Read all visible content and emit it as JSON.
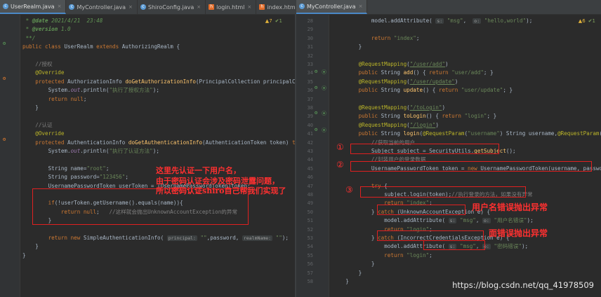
{
  "left_tabs": [
    {
      "name": "UserRealm.java",
      "icon": "c",
      "active": true
    },
    {
      "name": "MyController.java",
      "icon": "c",
      "active": false
    },
    {
      "name": "ShiroConfig.java",
      "icon": "c",
      "active": false
    },
    {
      "name": "login.html",
      "icon": "h",
      "active": false
    },
    {
      "name": "index.html",
      "icon": "h",
      "active": false
    }
  ],
  "right_tabs": [
    {
      "name": "MyController.java",
      "icon": "c",
      "active": true
    }
  ],
  "inspections": {
    "left": {
      "warnings": "7",
      "typos": "1"
    },
    "right": {
      "warnings": "6",
      "typos": "1"
    }
  },
  "left_code": [
    [
      [
        "doc",
        " * "
      ],
      [
        "dtag",
        "@date"
      ],
      [
        "doc",
        " 2021/4/21  23:48"
      ]
    ],
    [
      [
        "doc",
        " * "
      ],
      [
        "dtag",
        "@version"
      ],
      [
        "doc",
        " 1.0"
      ]
    ],
    [
      [
        "doc",
        " **/"
      ]
    ],
    [
      [
        "kw",
        "public class "
      ],
      [
        "t",
        "UserRealm "
      ],
      [
        "kw",
        "extends "
      ],
      [
        "t",
        "AuthorizingRealm {"
      ]
    ],
    [],
    [
      [
        "cmt",
        "    //授权"
      ]
    ],
    [
      [
        "ann",
        "    @Override"
      ]
    ],
    [
      [
        "kw",
        "    protected "
      ],
      [
        "t",
        "AuthorizationInfo "
      ],
      [
        "fn",
        "doGetAuthorizationInfo"
      ],
      [
        "t",
        "(PrincipalCollection principalColle"
      ]
    ],
    [
      [
        "t",
        "        System."
      ],
      [
        "fld",
        "out"
      ],
      [
        "t",
        ".println("
      ],
      [
        "str",
        "\"执行了授权方法\""
      ],
      [
        "t",
        ");"
      ]
    ],
    [
      [
        "kw",
        "        return null"
      ],
      [
        "t",
        ";"
      ]
    ],
    [
      [
        "t",
        "    }"
      ]
    ],
    [],
    [
      [
        "cmt",
        "    //认证"
      ]
    ],
    [
      [
        "ann",
        "    @Override"
      ]
    ],
    [
      [
        "kw",
        "    protected "
      ],
      [
        "t",
        "AuthenticationInfo "
      ],
      [
        "fn",
        "doGetAuthenticationInfo"
      ],
      [
        "t",
        "(AuthenticationToken token) "
      ],
      [
        "kw",
        "throw"
      ]
    ],
    [
      [
        "t",
        "        System."
      ],
      [
        "fld",
        "out"
      ],
      [
        "t",
        ".println("
      ],
      [
        "str",
        "\"执行了认证方法\""
      ],
      [
        "t",
        ");"
      ]
    ],
    [],
    [
      [
        "t",
        "        String name="
      ],
      [
        "str",
        "\"root\""
      ],
      [
        "t",
        ";"
      ]
    ],
    [
      [
        "t",
        "        String password="
      ],
      [
        "str",
        "\"123456\""
      ],
      [
        "t",
        ";"
      ]
    ],
    [
      [
        "t",
        "        UsernamePasswordToken userToken = (UsernamePasswordToken)token;"
      ]
    ],
    [],
    [
      [
        "kw",
        "        if"
      ],
      [
        "t",
        "(!userToken.getUsername().equals(name)){"
      ]
    ],
    [
      [
        "kw",
        "            return null"
      ],
      [
        "t",
        ";   "
      ],
      [
        "cmt",
        "//这样就会抛出UnknownAccountException的异常"
      ]
    ],
    [
      [
        "t",
        "        }"
      ]
    ],
    [],
    [
      [
        "kw",
        "        return new "
      ],
      [
        "t",
        "SimpleAuthenticationInfo( "
      ],
      [
        "pl",
        "principal:"
      ],
      [
        "t",
        " "
      ],
      [
        "str",
        "\"\""
      ],
      [
        "t",
        ",password, "
      ],
      [
        "pl",
        "realmName:"
      ],
      [
        "t",
        " "
      ],
      [
        "str",
        "\"\""
      ],
      [
        "t",
        ");"
      ]
    ],
    [
      [
        "t",
        "    }"
      ]
    ],
    [
      [
        "t",
        "}"
      ]
    ]
  ],
  "right_code": [
    [
      [
        "t",
        "            model.addAttribute( "
      ],
      [
        "pl",
        "s:"
      ],
      [
        "t",
        " "
      ],
      [
        "str",
        "\"msg\""
      ],
      [
        "t",
        ",  "
      ],
      [
        "pl",
        "o:"
      ],
      [
        "t",
        " "
      ],
      [
        "str",
        "\"hello,world\""
      ],
      [
        "t",
        ");"
      ]
    ],
    [],
    [
      [
        "kw",
        "            return "
      ],
      [
        "str",
        "\"index\""
      ],
      [
        "t",
        ";"
      ]
    ],
    [
      [
        "t",
        "        }"
      ]
    ],
    [],
    [
      [
        "ann",
        "        @RequestMapping"
      ],
      [
        "t",
        "("
      ],
      [
        "lnk",
        "\"/user/add\""
      ],
      [
        "t",
        ")"
      ]
    ],
    [
      [
        "kw",
        "        public "
      ],
      [
        "t",
        "String "
      ],
      [
        "fn",
        "add"
      ],
      [
        "t",
        "() { "
      ],
      [
        "kw",
        "return "
      ],
      [
        "str",
        "\"user/add\""
      ],
      [
        "t",
        "; }"
      ]
    ],
    [
      [
        "ann",
        "        @RequestMapping"
      ],
      [
        "t",
        "("
      ],
      [
        "lnk",
        "\"/user/update\""
      ],
      [
        "t",
        ")"
      ]
    ],
    [
      [
        "kw",
        "        public "
      ],
      [
        "t",
        "String "
      ],
      [
        "fn",
        "update"
      ],
      [
        "t",
        "() { "
      ],
      [
        "kw",
        "return "
      ],
      [
        "str",
        "\"user/update\""
      ],
      [
        "t",
        "; }"
      ]
    ],
    [],
    [
      [
        "ann",
        "        @RequestMapping"
      ],
      [
        "t",
        "("
      ],
      [
        "lnk",
        "\"/toLogin\""
      ],
      [
        "t",
        ")"
      ]
    ],
    [
      [
        "kw",
        "        public "
      ],
      [
        "t",
        "String "
      ],
      [
        "fn",
        "toLogin"
      ],
      [
        "t",
        "() { "
      ],
      [
        "kw",
        "return "
      ],
      [
        "str",
        "\"login\""
      ],
      [
        "t",
        "; }"
      ]
    ],
    [
      [
        "ann",
        "        @RequestMapping"
      ],
      [
        "t",
        "("
      ],
      [
        "lnk",
        "\"/login\""
      ],
      [
        "t",
        ")"
      ]
    ],
    [
      [
        "kw",
        "        public "
      ],
      [
        "t",
        "String "
      ],
      [
        "fn",
        "login"
      ],
      [
        "t",
        "("
      ],
      [
        "ann",
        "@RequestParam"
      ],
      [
        "t",
        "("
      ],
      [
        "str",
        "\"username\""
      ],
      [
        "t",
        ") String username,"
      ],
      [
        "ann",
        "@RequestParam"
      ],
      [
        "t",
        "("
      ],
      [
        "str",
        "\"pass"
      ]
    ],
    [
      [
        "cmt",
        "            //获取当前的用户"
      ]
    ],
    [
      [
        "t",
        "            Subject subject = SecurityUtils."
      ],
      [
        "fn",
        "getSubject"
      ],
      [
        "t",
        "();"
      ]
    ],
    [
      [
        "cmt",
        "            //封装用户的登录数据"
      ]
    ],
    [
      [
        "t",
        "            UsernamePasswordToken token = "
      ],
      [
        "kw",
        "new "
      ],
      [
        "t",
        "UsernamePasswordToken(username, password);"
      ]
    ],
    [],
    [
      [
        "kw",
        "            try "
      ],
      [
        "t",
        "{"
      ]
    ],
    [
      [
        "t",
        "                subject.login(token);"
      ],
      [
        "cmt",
        "//执行登录的方法，如果没有异常"
      ]
    ],
    [
      [
        "kw",
        "                return "
      ],
      [
        "str",
        "\"index\""
      ],
      [
        "t",
        ";"
      ]
    ],
    [
      [
        "t",
        "            } "
      ],
      [
        "kw",
        "catch "
      ],
      [
        "t",
        "(UnknownAccountException e) {"
      ]
    ],
    [
      [
        "t",
        "                model.addAttribute( "
      ],
      [
        "pl",
        "s:"
      ],
      [
        "t",
        " "
      ],
      [
        "str",
        "\"msg\""
      ],
      [
        "t",
        ", "
      ],
      [
        "pl",
        "o:"
      ],
      [
        "t",
        " "
      ],
      [
        "str",
        "\"用户名错误\""
      ],
      [
        "t",
        ");"
      ]
    ],
    [
      [
        "kw",
        "                return "
      ],
      [
        "str",
        "\"login\""
      ],
      [
        "t",
        ";"
      ]
    ],
    [
      [
        "t",
        "            } "
      ],
      [
        "kw",
        "catch "
      ],
      [
        "t",
        "(IncorrectCredentialsException e) {"
      ]
    ],
    [
      [
        "t",
        "                model.addAttribute( "
      ],
      [
        "pl",
        "s:"
      ],
      [
        "t",
        " "
      ],
      [
        "str",
        "\"msg\""
      ],
      [
        "t",
        ", "
      ],
      [
        "pl",
        "o:"
      ],
      [
        "t",
        " "
      ],
      [
        "str",
        "\"密码错误\""
      ],
      [
        "t",
        ");"
      ]
    ],
    [
      [
        "kw",
        "                return "
      ],
      [
        "str",
        "\"login\""
      ],
      [
        "t",
        ";"
      ]
    ],
    [
      [
        "t",
        "            }"
      ]
    ],
    [
      [
        "t",
        "        }"
      ]
    ],
    [
      [
        "t",
        "    }"
      ]
    ]
  ],
  "right_line_numbers": [
    "28",
    "29",
    "30",
    "31",
    "32",
    "33",
    "34",
    "35",
    "36",
    "37",
    "38",
    "39",
    "40",
    "41",
    "42",
    "43",
    "44",
    "45",
    "46",
    "47",
    "48",
    "49",
    "50",
    "51",
    "52",
    "53",
    "54",
    "55",
    "56",
    "57",
    "58"
  ],
  "annotations": {
    "left_note_lines": [
      "这里先认证一下用户名，",
      "由于密码认证会涉及密码泄露问题，",
      "所以密码认证shiro自己帮我们实现了"
    ],
    "circle_1": "①",
    "circle_2": "②",
    "circle_3": "③",
    "username_error_note": "用户名错误抛出异常",
    "password_error_note": "面错误抛出异常"
  },
  "watermark": "https://blog.csdn.net/qq_41978509"
}
